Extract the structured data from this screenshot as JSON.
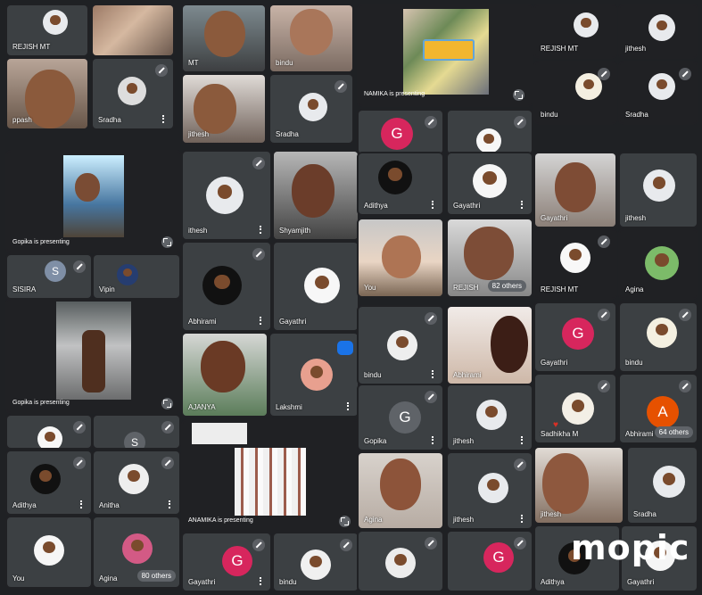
{
  "brand": {
    "watermark": "mopic"
  },
  "labels": {
    "rejish_mt": "REJISH MT",
    "rejish_mt_partial": "MT",
    "bindu": "bindu",
    "prakash_partial": "ppash",
    "sradha": "Sradha",
    "jithesh": "jithesh",
    "ithesh": "ithesh",
    "namika_presenting": "NAMIKA is presenting",
    "adithya": "Adithya",
    "gayathri": "Gayathri",
    "gopika_presenting": "Gopika is presenting",
    "sisira": "SISIRA",
    "vipin": "Vipin",
    "abhirami": "Abhirami",
    "shyamjith": "Shyamjith",
    "you": "You",
    "rejish_partial": "REJISH",
    "others_82": "82 others",
    "agina": "Agina",
    "ajanya": "AJANYA",
    "lakshmi": "Lakshmi",
    "abhirami_mid": "Abhirami",
    "gopika": "Gopika",
    "sadhikha": "Sadhikha M",
    "others_64": "64 others",
    "anitha": "Anitha",
    "anamika_presenting": "ANAMIKA is presenting",
    "others_80": "80 others",
    "adithya_bottom": "Adithya",
    "gayathri_bottom": "Gayathri"
  },
  "letters": {
    "g": "G",
    "s": "S",
    "a": "A"
  },
  "colors": {
    "tile": "#3c4043",
    "background": "#1f2124",
    "pink": "#d7265d",
    "gray_letter": "#5f6368",
    "orange": "#e65100",
    "blue": "#7f8fa6"
  }
}
